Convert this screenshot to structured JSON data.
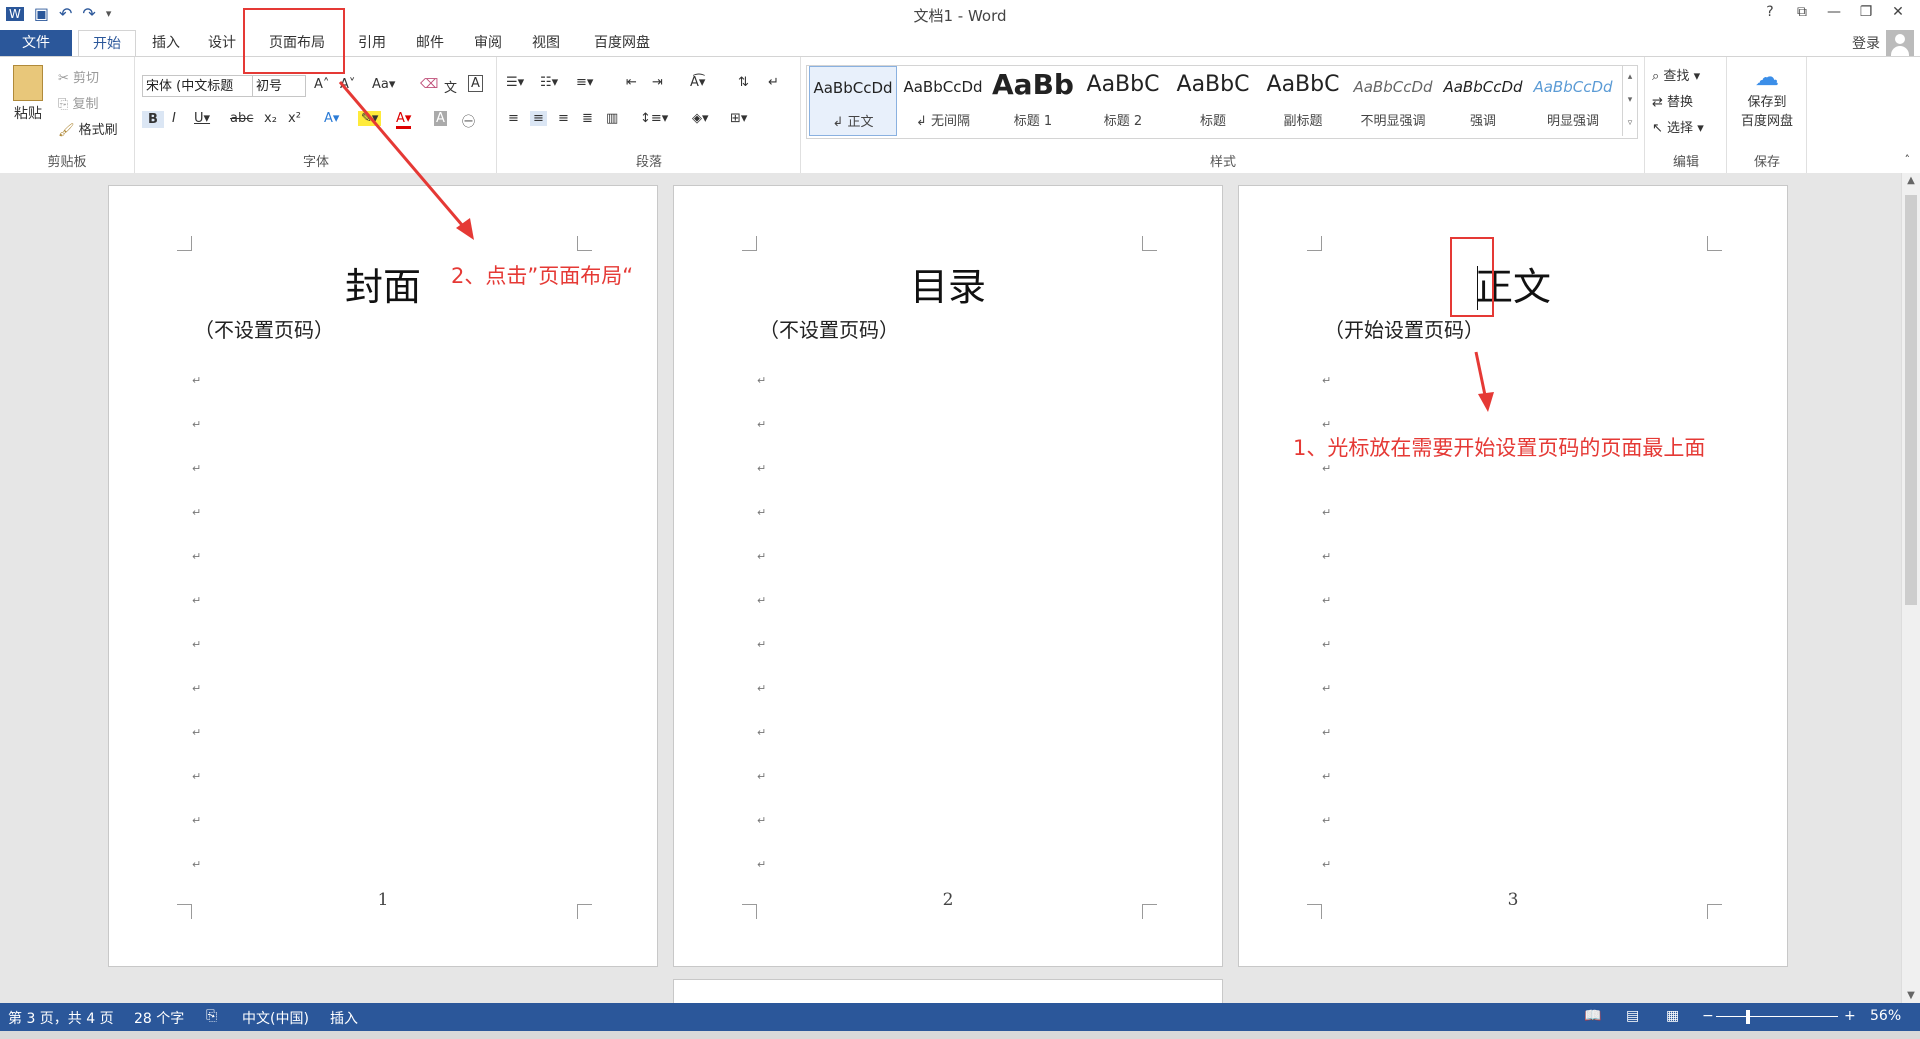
{
  "window": {
    "title": "文档1 - Word",
    "controls": [
      "?",
      "⧉",
      "—",
      "❐",
      "✕"
    ]
  },
  "quick_access": {
    "icons": [
      "word-app-icon",
      "save-icon",
      "undo-icon",
      "redo-icon",
      "customize-icon"
    ]
  },
  "tabs": [
    {
      "label": "文件"
    },
    {
      "label": "开始"
    },
    {
      "label": "插入"
    },
    {
      "label": "设计"
    },
    {
      "label": "页面布局"
    },
    {
      "label": "引用"
    },
    {
      "label": "邮件"
    },
    {
      "label": "审阅"
    },
    {
      "label": "视图"
    },
    {
      "label": "百度网盘"
    }
  ],
  "account": {
    "login": "登录"
  },
  "ribbon": {
    "clipboard": {
      "label": "剪贴板",
      "paste": "粘贴",
      "cut": "剪切",
      "copy": "复制",
      "format_painter": "格式刷"
    },
    "font": {
      "label": "字体",
      "font_name": "宋体 (中文标题",
      "font_size": "初号"
    },
    "paragraph": {
      "label": "段落"
    },
    "styles": {
      "label": "样式",
      "items": [
        {
          "sample": "AaBbCcDd",
          "name": "↲ 正文"
        },
        {
          "sample": "AaBbCcDd",
          "name": "↲ 无间隔"
        },
        {
          "sample": "AaBb",
          "name": "标题 1"
        },
        {
          "sample": "AaBbC",
          "name": "标题 2"
        },
        {
          "sample": "AaBbC",
          "name": "标题"
        },
        {
          "sample": "AaBbC",
          "name": "副标题"
        },
        {
          "sample": "AaBbCcDd",
          "name": "不明显强调"
        },
        {
          "sample": "AaBbCcDd",
          "name": "强调"
        },
        {
          "sample": "AaBbCcDd",
          "name": "明显强调"
        }
      ]
    },
    "editing": {
      "label": "编辑",
      "find": "查找",
      "replace": "替换",
      "select": "选择"
    },
    "save": {
      "label": "保存",
      "button_line1": "保存到",
      "button_line2": "百度网盘"
    }
  },
  "pages": [
    {
      "heading": "封面",
      "sub": "（不设置页码）",
      "page_number": "1"
    },
    {
      "heading": "目录",
      "sub": "（不设置页码）",
      "page_number": "2"
    },
    {
      "heading": "正文",
      "sub": "（开始设置页码）",
      "page_number": "3"
    }
  ],
  "annotations": {
    "step1": "1、光标放在需要开始设置页码的页面最上面",
    "step2": "2、点击”页面布局“",
    "color": "#e53935"
  },
  "status": {
    "page": "第 3 页，共 4 页",
    "words": "28 个字",
    "language": "中文(中国)",
    "mode": "插入",
    "zoom": "56%"
  },
  "theme": {
    "accent": "#2b579a"
  }
}
